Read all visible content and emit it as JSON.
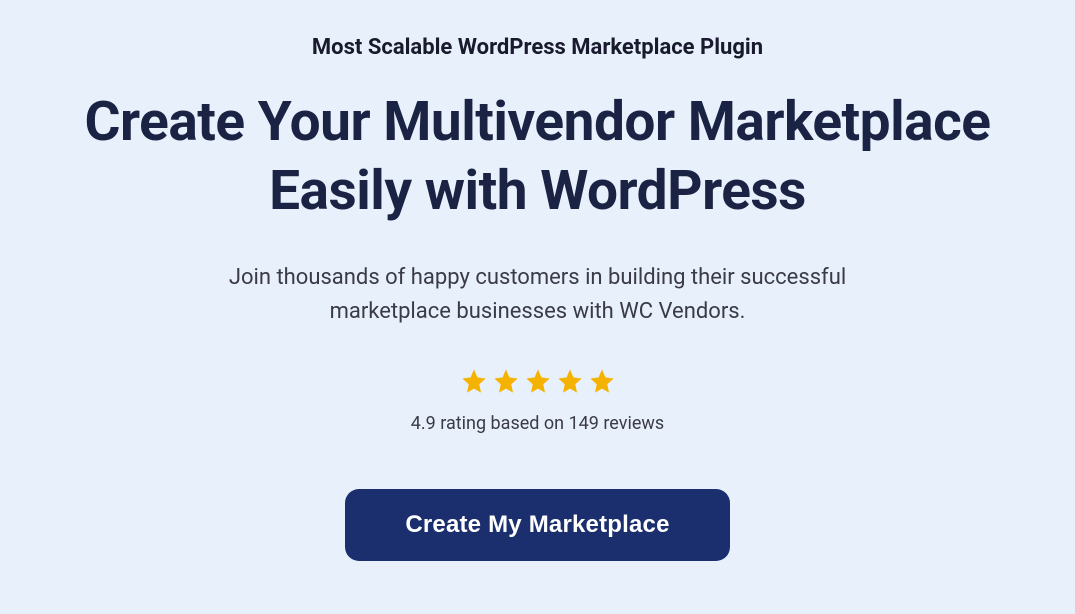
{
  "hero": {
    "eyebrow": "Most Scalable WordPress Marketplace Plugin",
    "headline": "Create Your Multivendor Marketplace Easily with WordPress",
    "subheadline": "Join thousands of happy customers in building their successful marketplace businesses with WC Vendors.",
    "rating_text": "4.9 rating based on 149 reviews",
    "cta_label": "Create My Marketplace",
    "star_count": 5
  },
  "colors": {
    "background": "#e8f1fb",
    "heading": "#1a2344",
    "body_text": "#3a3a4a",
    "star": "#f5b301",
    "button_bg": "#1b2f6e",
    "button_text": "#ffffff"
  }
}
